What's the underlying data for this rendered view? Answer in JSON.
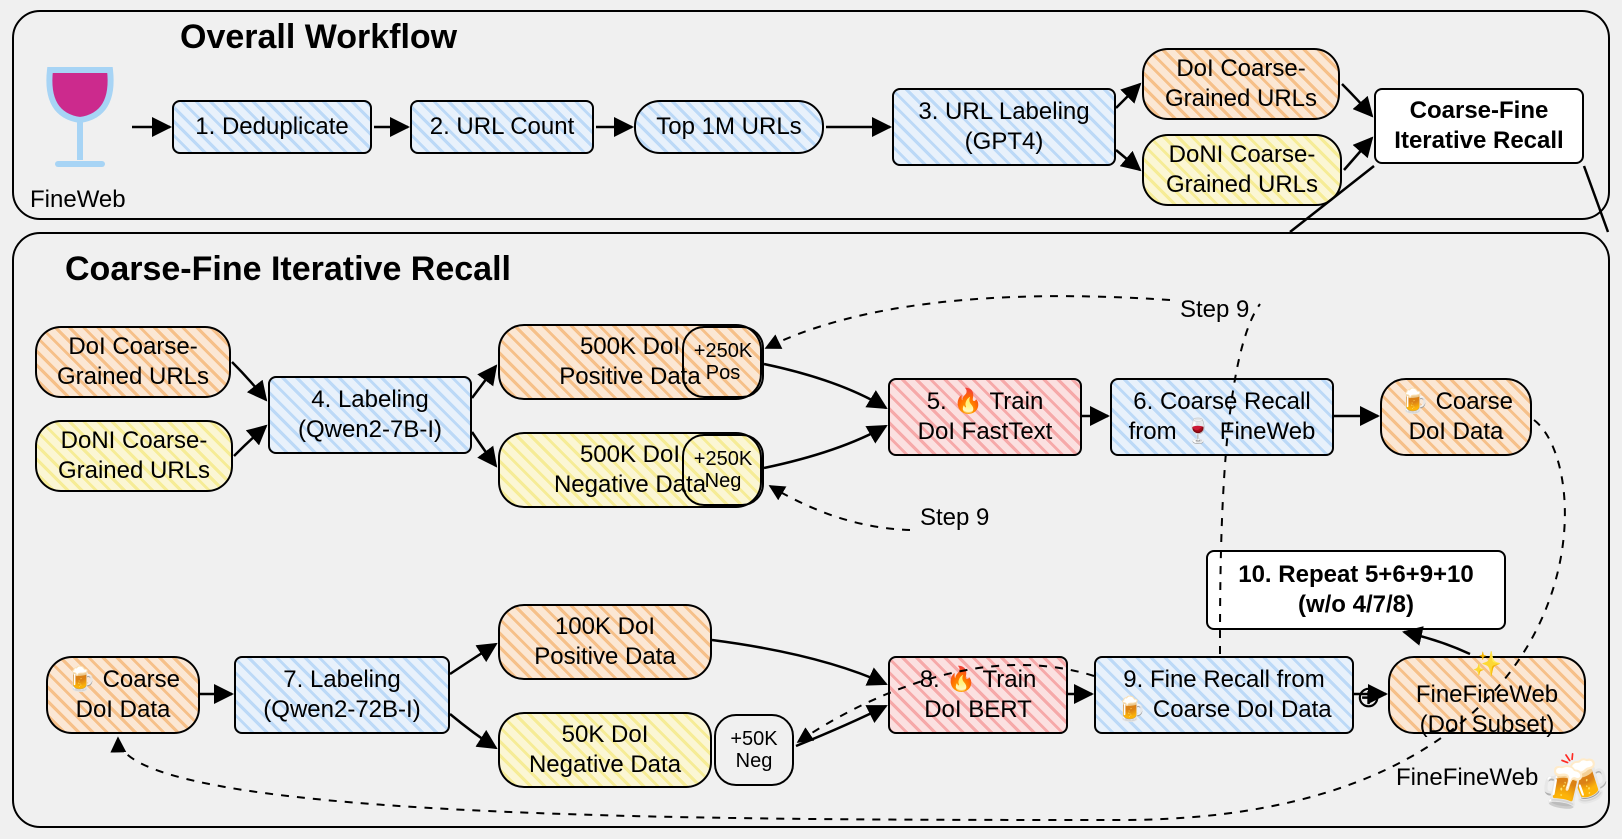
{
  "top": {
    "title": "Overall Workflow",
    "fineweb_label": "FineWeb",
    "step1": "1. Deduplicate",
    "step2": "2. URL Count",
    "top1m": "Top 1M URLs",
    "step3": "3. URL Labeling\n(GPT4)",
    "doi_coarse": "DoI Coarse-\nGrained URLs",
    "doni_coarse": "DoNI Coarse-\nGrained URLs",
    "coarse_fine_box": "Coarse-Fine\nIterative Recall"
  },
  "bottom": {
    "title": "Coarse-Fine Iterative Recall",
    "doi_coarse": "DoI Coarse-\nGrained URLs",
    "doni_coarse": "DoNI Coarse-\nGrained URLs",
    "step4": "4. Labeling\n(Qwen2-7B-I)",
    "pos500k": "500K DoI\nPositive Data",
    "pos_addon": "+250K\nPos",
    "neg500k": "500K DoI\nNegative Data",
    "neg_addon": "+250K\nNeg",
    "step5": "5. 🔥 Train\nDoI FastText",
    "step6": "6. Coarse Recall\nfrom 🍷 FineWeb",
    "coarse_doi": "🍺 Coarse\nDoI Data",
    "step9_label_a": "Step 9",
    "step9_label_b": "Step 9",
    "coarse_doi_2": "🍺 Coarse\nDoI Data",
    "step7": "7. Labeling\n(Qwen2-72B-I)",
    "pos100k": "100K DoI\nPositive Data",
    "neg50k": "50K DoI\nNegative Data",
    "neg50k_addon": "+50K\nNeg",
    "step8": "8. 🔥 Train\nDoI BERT",
    "step9": "9. Fine Recall from\n🍺 Coarse DoI Data",
    "finefineweb_box": "✨ FineFineWeb\n(DoI Subset)",
    "step10": "10. Repeat 5+6+9+10\n(w/o 4/7/8)",
    "finefineweb_label": "FineFineWeb",
    "oplus": "⊕"
  },
  "icons": {
    "wine": "🍷",
    "beer": "🍺",
    "beers": "🍻",
    "fire": "🔥",
    "sparkles": "✨"
  }
}
